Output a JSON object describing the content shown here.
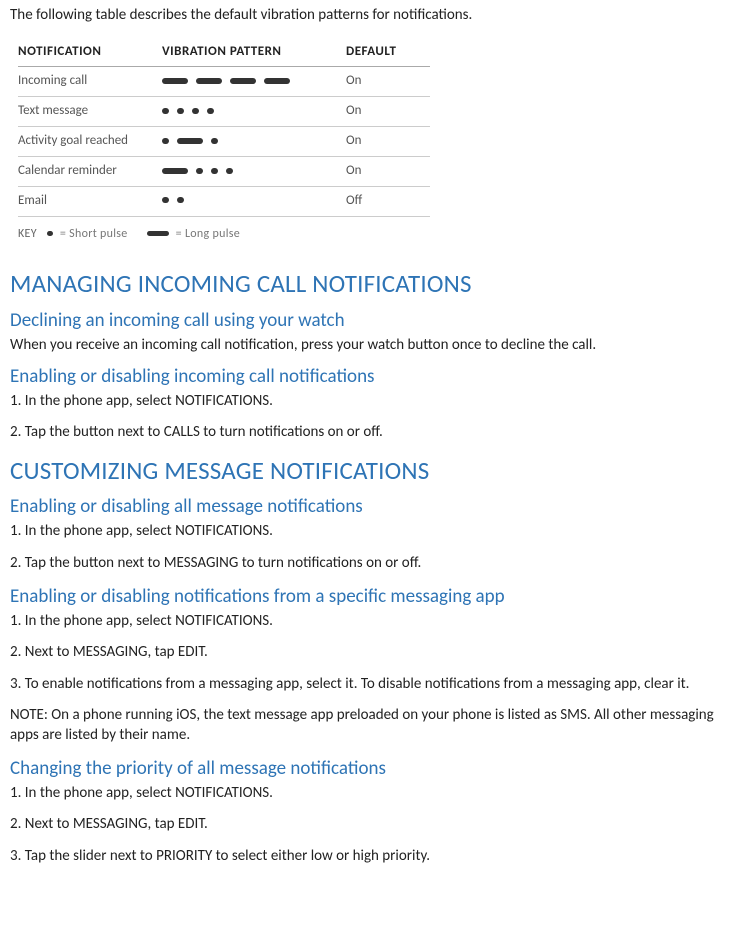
{
  "intro": "The following table describes the default vibration patterns for notifications.",
  "table": {
    "headers": {
      "notification": "NOTIFICATION",
      "pattern": "VIBRATION PATTERN",
      "default_": "DEFAULT"
    },
    "rows": [
      {
        "name": "Incoming call",
        "pattern": "LLLL",
        "default_": "On"
      },
      {
        "name": "Text message",
        "pattern": "SSSS",
        "default_": "On"
      },
      {
        "name": "Activity goal reached",
        "pattern": "SLS",
        "default_": "On"
      },
      {
        "name": "Calendar reminder",
        "pattern": "LSSS",
        "default_": "On"
      },
      {
        "name": "Email",
        "pattern": "SS",
        "default_": "Off"
      }
    ]
  },
  "key": {
    "label": "KEY",
    "short": "= Short pulse",
    "long": "= Long pulse"
  },
  "sections": {
    "managing": {
      "title": "MANAGING INCOMING CALL NOTIFICATIONS",
      "declining": {
        "title": "Declining an incoming call using your watch",
        "body": "When you receive an incoming call notification, press your watch button once to decline the call."
      },
      "enabling": {
        "title": "Enabling or disabling incoming call notifications",
        "steps": [
          "1. In the phone app, select NOTIFICATIONS.",
          "2. Tap the button next to CALLS to turn notifications on or off."
        ]
      }
    },
    "customizing": {
      "title": "CUSTOMIZING MESSAGE NOTIFICATIONS",
      "all": {
        "title": "Enabling or disabling all message notifications",
        "steps": [
          "1. In the phone app, select NOTIFICATIONS.",
          "2. Tap the button next to MESSAGING to turn notifications on or off."
        ]
      },
      "specific": {
        "title": "Enabling or disabling notifications from a specific messaging app",
        "steps": [
          "1. In the phone app, select NOTIFICATIONS.",
          "2. Next to MESSAGING, tap EDIT.",
          "3. To enable notifications from a messaging app, select it. To disable notifications from a messaging app, clear it."
        ],
        "note": "NOTE: On a phone running iOS, the text message app preloaded on your phone is listed as SMS. All other messaging apps are listed by their name."
      },
      "priority": {
        "title": "Changing the priority of all message notifications",
        "steps": [
          "1. In the phone app, select NOTIFICATIONS.",
          "2. Next to MESSAGING, tap EDIT.",
          "3. Tap the slider next to PRIORITY to select either low or high priority."
        ]
      }
    }
  }
}
